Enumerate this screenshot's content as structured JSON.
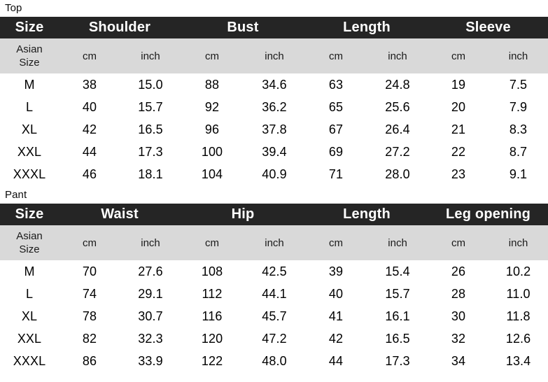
{
  "sections": [
    {
      "caption": "Top",
      "header": {
        "size_label": "Size",
        "groups": [
          "Shoulder",
          "Bust",
          "Length",
          "Sleeve"
        ]
      },
      "units_row": {
        "size_label_line1": "Asian",
        "size_label_line2": "Size",
        "units": [
          "cm",
          "inch",
          "cm",
          "inch",
          "cm",
          "inch",
          "cm",
          "inch"
        ]
      },
      "rows": [
        {
          "size": "M",
          "values": [
            "38",
            "15.0",
            "88",
            "34.6",
            "63",
            "24.8",
            "19",
            "7.5"
          ]
        },
        {
          "size": "L",
          "values": [
            "40",
            "15.7",
            "92",
            "36.2",
            "65",
            "25.6",
            "20",
            "7.9"
          ]
        },
        {
          "size": "XL",
          "values": [
            "42",
            "16.5",
            "96",
            "37.8",
            "67",
            "26.4",
            "21",
            "8.3"
          ]
        },
        {
          "size": "XXL",
          "values": [
            "44",
            "17.3",
            "100",
            "39.4",
            "69",
            "27.2",
            "22",
            "8.7"
          ]
        },
        {
          "size": "XXXL",
          "values": [
            "46",
            "18.1",
            "104",
            "40.9",
            "71",
            "28.0",
            "23",
            "9.1"
          ]
        }
      ]
    },
    {
      "caption": "Pant",
      "header": {
        "size_label": "Size",
        "groups": [
          "Waist",
          "Hip",
          "Length",
          "Leg opening"
        ]
      },
      "units_row": {
        "size_label_line1": "Asian",
        "size_label_line2": "Size",
        "units": [
          "cm",
          "inch",
          "cm",
          "inch",
          "cm",
          "inch",
          "cm",
          "inch"
        ]
      },
      "rows": [
        {
          "size": "M",
          "values": [
            "70",
            "27.6",
            "108",
            "42.5",
            "39",
            "15.4",
            "26",
            "10.2"
          ]
        },
        {
          "size": "L",
          "values": [
            "74",
            "29.1",
            "112",
            "44.1",
            "40",
            "15.7",
            "28",
            "11.0"
          ]
        },
        {
          "size": "XL",
          "values": [
            "78",
            "30.7",
            "116",
            "45.7",
            "41",
            "16.1",
            "30",
            "11.8"
          ]
        },
        {
          "size": "XXL",
          "values": [
            "82",
            "32.3",
            "120",
            "47.2",
            "42",
            "16.5",
            "32",
            "12.6"
          ]
        },
        {
          "size": "XXXL",
          "values": [
            "86",
            "33.9",
            "122",
            "48.0",
            "44",
            "17.3",
            "34",
            "13.4"
          ]
        }
      ]
    }
  ],
  "colors": {
    "header_band": "#252525",
    "units_band": "#d9d9d9",
    "page_background": "#ffffff",
    "header_text": "#ffffff",
    "body_text": "#000000"
  },
  "chart_data": {
    "type": "table",
    "title": "Garment size chart",
    "tables": [
      {
        "name": "Top",
        "columns": [
          "Size (Asian Size)",
          "Shoulder cm",
          "Shoulder inch",
          "Bust cm",
          "Bust inch",
          "Length cm",
          "Length inch",
          "Sleeve cm",
          "Sleeve inch"
        ],
        "rows": [
          [
            "M",
            38,
            15.0,
            88,
            34.6,
            63,
            24.8,
            19,
            7.5
          ],
          [
            "L",
            40,
            15.7,
            92,
            36.2,
            65,
            25.6,
            20,
            7.9
          ],
          [
            "XL",
            42,
            16.5,
            96,
            37.8,
            67,
            26.4,
            21,
            8.3
          ],
          [
            "XXL",
            44,
            17.3,
            100,
            39.4,
            69,
            27.2,
            22,
            8.7
          ],
          [
            "XXXL",
            46,
            18.1,
            104,
            40.9,
            71,
            28.0,
            23,
            9.1
          ]
        ]
      },
      {
        "name": "Pant",
        "columns": [
          "Size (Asian Size)",
          "Waist cm",
          "Waist inch",
          "Hip cm",
          "Hip inch",
          "Length cm",
          "Length inch",
          "Leg opening cm",
          "Leg opening inch"
        ],
        "rows": [
          [
            "M",
            70,
            27.6,
            108,
            42.5,
            39,
            15.4,
            26,
            10.2
          ],
          [
            "L",
            74,
            29.1,
            112,
            44.1,
            40,
            15.7,
            28,
            11.0
          ],
          [
            "XL",
            78,
            30.7,
            116,
            45.7,
            41,
            16.1,
            30,
            11.8
          ],
          [
            "XXL",
            82,
            32.3,
            120,
            47.2,
            42,
            16.5,
            32,
            12.6
          ],
          [
            "XXXL",
            86,
            33.9,
            122,
            48.0,
            44,
            17.3,
            34,
            13.4
          ]
        ]
      }
    ]
  }
}
